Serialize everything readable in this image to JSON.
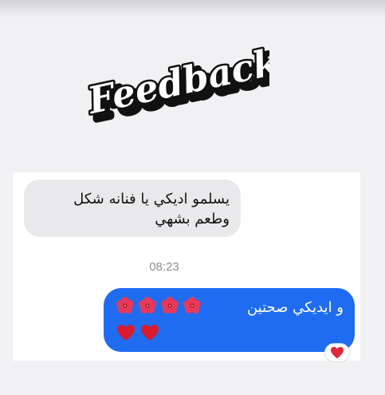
{
  "logo": {
    "text": "Feedback"
  },
  "messages": {
    "incoming": {
      "line1": "يسلمو اديكي يا فنانه شكل",
      "line2": "وطعم بشهي"
    },
    "timestamp": "08:23",
    "outgoing": {
      "text": "و ايديكي صحتين",
      "emojis": [
        "hibiscus-icon",
        "hibiscus-icon",
        "hibiscus-icon",
        "hibiscus-icon",
        "heart-icon",
        "heart-icon"
      ]
    },
    "reaction": "heart-icon"
  },
  "colors": {
    "outgoing_bubble": "#1f6cf0",
    "incoming_bubble": "#e9e9eb",
    "logo_fill": "#ffffff",
    "logo_outline": "#111111"
  }
}
